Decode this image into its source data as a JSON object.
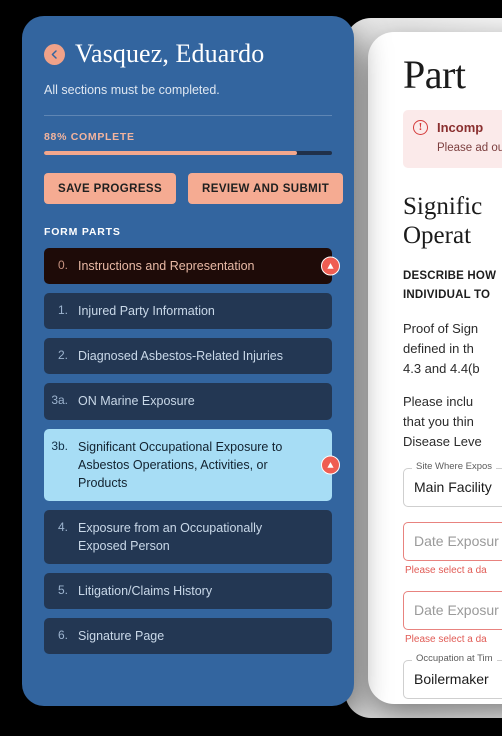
{
  "sidebar": {
    "back_icon": "back-arrow-icon",
    "claimant_name": "Vasquez, Eduardo",
    "subtitle": "All sections must be completed.",
    "progress": {
      "label": "88% COMPLETE",
      "percent": 88
    },
    "buttons": {
      "save": "SAVE PROGRESS",
      "review": "REVIEW AND SUBMIT"
    },
    "parts_label": "FORM PARTS",
    "parts": [
      {
        "num": "0.",
        "label": "Instructions and Representation",
        "state": "incomplete",
        "badge": "warning-icon"
      },
      {
        "num": "1.",
        "label": "Injured Party Information",
        "state": "default",
        "badge": null
      },
      {
        "num": "2.",
        "label": "Diagnosed Asbestos-Related Injuries",
        "state": "default",
        "badge": null
      },
      {
        "num": "3a.",
        "label": "ON Marine Exposure",
        "state": "default",
        "badge": null
      },
      {
        "num": "3b.",
        "label": "Significant Occupational Exposure to Asbestos Operations, Activities, or Products",
        "state": "active",
        "badge": "warning-icon"
      },
      {
        "num": "4.",
        "label": "Exposure from an Occupationally Exposed Person",
        "state": "default",
        "badge": null
      },
      {
        "num": "5.",
        "label": "Litigation/Claims History",
        "state": "default",
        "badge": null
      },
      {
        "num": "6.",
        "label": "Signature Page",
        "state": "default",
        "badge": null
      }
    ]
  },
  "document": {
    "title": "Part",
    "alert": {
      "icon": "error-circle-icon",
      "title": "Incomp",
      "body": "Please ad\nout fields"
    },
    "section_heading_line1": "Signific",
    "section_heading_line2": "Operat",
    "describe_line1": "DESCRIBE HOW",
    "describe_line2": "INDIVIDUAL TO",
    "para1_line1": "Proof of Sign",
    "para1_line2": "defined in th",
    "para1_line3": "4.3 and 4.4(b",
    "para2_line1": "Please inclu",
    "para2_line2": "that you thin",
    "para2_line3": "Disease Leve",
    "fields": [
      {
        "legend": "Site Where Expos",
        "value": "Main Facility",
        "placeholder": "",
        "error": "",
        "state": "filled"
      },
      {
        "legend": "",
        "value": "",
        "placeholder": "Date Exposur",
        "error": "Please select a da",
        "state": "error"
      },
      {
        "legend": "",
        "value": "",
        "placeholder": "Date Exposur",
        "error": "Please select a da",
        "state": "error"
      },
      {
        "legend": "Occupation at Tim",
        "value": "Boilermaker",
        "placeholder": "",
        "error": "",
        "state": "filled"
      }
    ]
  },
  "colors": {
    "sidebar_bg": "#33659f",
    "accent_salmon": "#f5ab92",
    "item_bg": "#233753",
    "item_active_bg": "#a7ddf5",
    "item_incomplete_bg": "#1e0b08",
    "badge_red": "#ef5d52",
    "error_red": "#e15b55",
    "alert_bg": "#fbeaea"
  }
}
